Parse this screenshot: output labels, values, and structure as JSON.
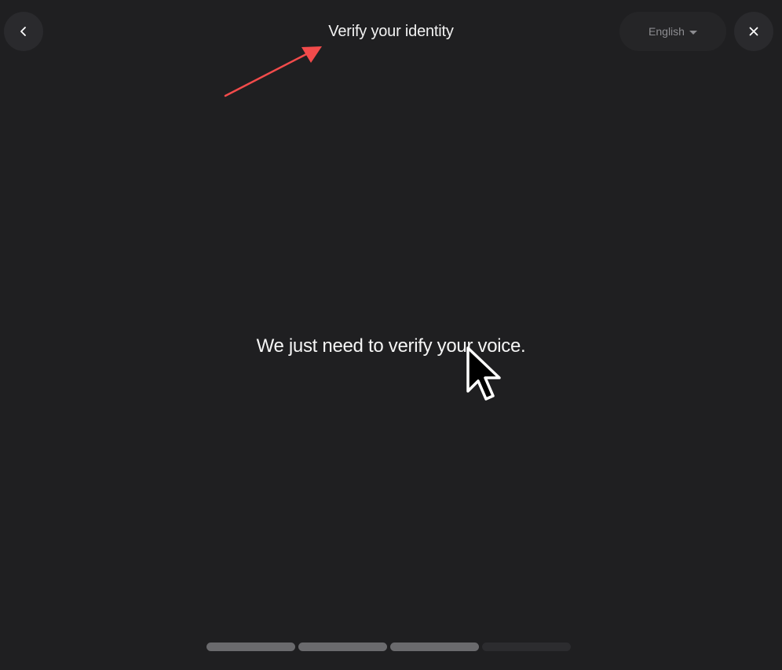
{
  "header": {
    "title": "Verify your identity",
    "back_icon": "chevron-left-icon",
    "close_icon": "close-icon",
    "language": {
      "selected": "English",
      "icon": "caret-down-icon"
    }
  },
  "main": {
    "message": "We just need to verify your voice."
  },
  "progress": {
    "total_steps": 4,
    "completed_steps": 3
  },
  "colors": {
    "background": "#1f1f21",
    "button_bg": "#2a2a2d",
    "progress_done": "#6a6a6d",
    "progress_todo": "#2c2c2f",
    "annotation": "#f24b4b"
  }
}
